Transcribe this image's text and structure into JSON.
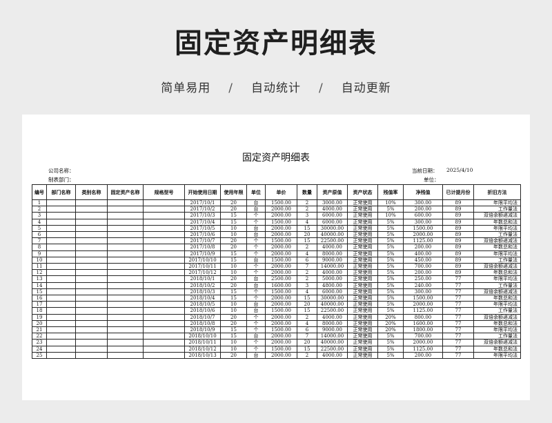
{
  "banner": {
    "title": "固定资产明细表",
    "tags": [
      "简单易用",
      "自动统计",
      "自动更新"
    ],
    "separator": "/"
  },
  "sheet": {
    "title": "固定资产明细表",
    "company_label": "公司名称：",
    "department_label": "制表部门：",
    "date_label": "当前日期：",
    "date_value": "2025/4/10",
    "unit_label": "单位："
  },
  "table": {
    "headers": [
      "编号",
      "部门名称",
      "类别名称",
      "固定资产名称",
      "规格型号",
      "开始使用日期",
      "使用年限",
      "单位",
      "单价",
      "数量",
      "资产原值",
      "资产状态",
      "残值率",
      "净残值",
      "已计提月份",
      "折旧方法"
    ],
    "rows": [
      [
        "1",
        "",
        "",
        "",
        "",
        "2017/10/1",
        "20",
        "台",
        "1500.00",
        "2",
        "3000.00",
        "正常使用",
        "10%",
        "300.00",
        "89",
        "年限平均法"
      ],
      [
        "2",
        "",
        "",
        "",
        "",
        "2017/10/2",
        "20",
        "台",
        "2000.00",
        "2",
        "4000.00",
        "正常使用",
        "5%",
        "200.00",
        "89",
        "工作量法"
      ],
      [
        "3",
        "",
        "",
        "",
        "",
        "2017/10/3",
        "15",
        "个",
        "2000.00",
        "3",
        "6000.00",
        "正常使用",
        "10%",
        "600.00",
        "89",
        "双倍余额递减法"
      ],
      [
        "4",
        "",
        "",
        "",
        "",
        "2017/10/4",
        "15",
        "个",
        "1500.00",
        "4",
        "6000.00",
        "正常使用",
        "5%",
        "300.00",
        "89",
        "年数总和法"
      ],
      [
        "5",
        "",
        "",
        "",
        "",
        "2017/10/5",
        "10",
        "台",
        "2000.00",
        "15",
        "30000.00",
        "正常使用",
        "5%",
        "1500.00",
        "89",
        "年限平均法"
      ],
      [
        "6",
        "",
        "",
        "",
        "",
        "2017/10/6",
        "10",
        "台",
        "2000.00",
        "20",
        "40000.00",
        "正常使用",
        "5%",
        "2000.00",
        "89",
        "工作量法"
      ],
      [
        "7",
        "",
        "",
        "",
        "",
        "2017/10/7",
        "20",
        "个",
        "1500.00",
        "15",
        "22500.00",
        "正常使用",
        "5%",
        "1125.00",
        "89",
        "双倍余额递减法"
      ],
      [
        "8",
        "",
        "",
        "",
        "",
        "2017/10/8",
        "20",
        "个",
        "2000.00",
        "2",
        "4000.00",
        "正常使用",
        "5%",
        "200.00",
        "89",
        "年数总和法"
      ],
      [
        "9",
        "",
        "",
        "",
        "",
        "2017/10/9",
        "15",
        "个",
        "2000.00",
        "4",
        "8000.00",
        "正常使用",
        "5%",
        "400.00",
        "89",
        "年限平均法"
      ],
      [
        "10",
        "",
        "",
        "",
        "",
        "2017/10/10",
        "15",
        "台",
        "1500.00",
        "6",
        "9000.00",
        "正常使用",
        "5%",
        "450.00",
        "89",
        "工作量法"
      ],
      [
        "11",
        "",
        "",
        "",
        "",
        "2017/10/11",
        "10",
        "个",
        "2000.00",
        "7",
        "14000.00",
        "正常使用",
        "5%",
        "700.00",
        "89",
        "双倍余额递减法"
      ],
      [
        "12",
        "",
        "",
        "",
        "",
        "2017/10/12",
        "10",
        "个",
        "2000.00",
        "2",
        "4000.00",
        "正常使用",
        "5%",
        "200.00",
        "89",
        "年数总和法"
      ],
      [
        "13",
        "",
        "",
        "",
        "",
        "2018/10/1",
        "20",
        "台",
        "2500.00",
        "2",
        "5000.00",
        "正常使用",
        "5%",
        "250.00",
        "77",
        "年限平均法"
      ],
      [
        "14",
        "",
        "",
        "",
        "",
        "2018/10/2",
        "20",
        "台",
        "1600.00",
        "3",
        "4800.00",
        "正常使用",
        "5%",
        "240.00",
        "77",
        "工作量法"
      ],
      [
        "15",
        "",
        "",
        "",
        "",
        "2018/10/3",
        "15",
        "个",
        "1500.00",
        "4",
        "6000.00",
        "正常使用",
        "5%",
        "300.00",
        "77",
        "双倍余额递减法"
      ],
      [
        "16",
        "",
        "",
        "",
        "",
        "2018/10/4",
        "15",
        "个",
        "2000.00",
        "15",
        "30000.00",
        "正常使用",
        "5%",
        "1500.00",
        "77",
        "年数总和法"
      ],
      [
        "17",
        "",
        "",
        "",
        "",
        "2018/10/5",
        "10",
        "台",
        "2000.00",
        "20",
        "40000.00",
        "正常使用",
        "5%",
        "2000.00",
        "77",
        "年限平均法"
      ],
      [
        "18",
        "",
        "",
        "",
        "",
        "2018/10/6",
        "10",
        "台",
        "1500.00",
        "15",
        "22500.00",
        "正常使用",
        "5%",
        "1125.00",
        "77",
        "工作量法"
      ],
      [
        "19",
        "",
        "",
        "",
        "",
        "2018/10/7",
        "20",
        "个",
        "2000.00",
        "2",
        "4000.00",
        "正常使用",
        "20%",
        "800.00",
        "77",
        "双倍余额递减法"
      ],
      [
        "20",
        "",
        "",
        "",
        "",
        "2018/10/8",
        "20",
        "个",
        "2000.00",
        "4",
        "8000.00",
        "正常使用",
        "20%",
        "1600.00",
        "77",
        "年数总和法"
      ],
      [
        "21",
        "",
        "",
        "",
        "",
        "2018/10/9",
        "15",
        "个",
        "1500.00",
        "6",
        "9000.00",
        "正常使用",
        "20%",
        "1800.00",
        "77",
        "年限平均法"
      ],
      [
        "22",
        "",
        "",
        "",
        "",
        "2018/10/10",
        "15",
        "台",
        "2000.00",
        "7",
        "14000.00",
        "正常使用",
        "5%",
        "700.00",
        "77",
        "工作量法"
      ],
      [
        "23",
        "",
        "",
        "",
        "",
        "2018/10/11",
        "10",
        "个",
        "2000.00",
        "20",
        "40000.00",
        "正常使用",
        "5%",
        "2000.00",
        "77",
        "双倍余额递减法"
      ],
      [
        "24",
        "",
        "",
        "",
        "",
        "2018/10/12",
        "10",
        "个",
        "1500.00",
        "15",
        "22500.00",
        "正常使用",
        "5%",
        "1125.00",
        "77",
        "年数总和法"
      ],
      [
        "25",
        "",
        "",
        "",
        "",
        "2018/10/13",
        "20",
        "台",
        "2000.00",
        "2",
        "4000.00",
        "正常使用",
        "5%",
        "200.00",
        "77",
        "年限平均法"
      ]
    ]
  }
}
